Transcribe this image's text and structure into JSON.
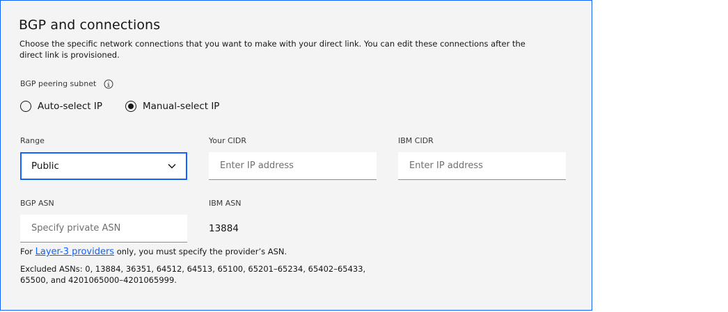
{
  "section": {
    "title": "BGP and connections",
    "description": "Choose the specific network connections that you want to make with your direct link. You can edit these connections after the direct link is provisioned."
  },
  "bgp_peering": {
    "label": "BGP peering subnet",
    "info_icon": "info-icon",
    "options": [
      {
        "label": "Auto-select IP",
        "selected": false
      },
      {
        "label": "Manual-select IP",
        "selected": true
      }
    ]
  },
  "range": {
    "label": "Range",
    "value": "Public",
    "icon": "chevron-down-icon"
  },
  "your_cidr": {
    "label": "Your CIDR",
    "placeholder": "Enter IP address",
    "value": ""
  },
  "ibm_cidr": {
    "label": "IBM CIDR",
    "placeholder": "Enter IP address",
    "value": ""
  },
  "bgp_asn": {
    "label": "BGP ASN",
    "placeholder": "Specify private ASN",
    "value": ""
  },
  "ibm_asn": {
    "label": "IBM ASN",
    "value": "13884"
  },
  "helper": {
    "prefix": "For ",
    "link": "Layer-3 providers",
    "suffix": " only, you must specify the provider’s ASN."
  },
  "excluded_asns": "Excluded ASNs: 0, 13884, 36351, 64512, 64513, 65100, 65201–65234, 65402–65433, 65500, and 4201065000–4201065999.",
  "colors": {
    "accent": "#0f62fe",
    "panel_bg": "#f4f4f4",
    "text": "#161616"
  }
}
